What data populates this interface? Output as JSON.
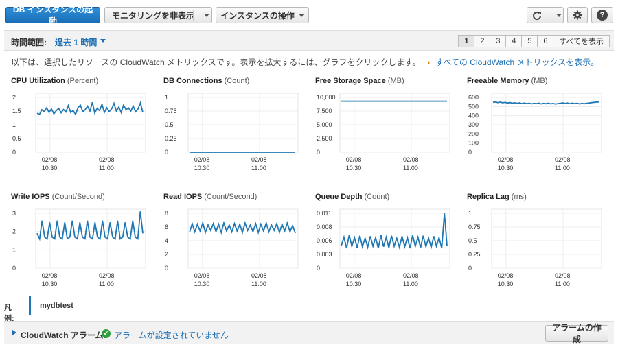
{
  "toolbar": {
    "launch_label": "DB インスタンスの起動",
    "monitoring_label": "モニタリングを非表示",
    "instance_actions_label": "インスタンスの操作",
    "refresh_icon": "refresh-icon",
    "settings_icon": "gear-icon",
    "help_icon": "help-icon",
    "help_glyph": "?"
  },
  "time_range": {
    "label": "時間範囲:",
    "value": "過去 1 時間",
    "pages": [
      "1",
      "2",
      "3",
      "4",
      "5",
      "6"
    ],
    "active_page": "1",
    "show_all_label": "すべてを表示"
  },
  "description": {
    "text": "以下は、選択したリソースの CloudWatch メトリックスです。表示を拡大するには、グラフをクリックします。",
    "arrow": "›",
    "link": "すべての CloudWatch メトリックスを表示。"
  },
  "colors": {
    "series": "#1f77b4",
    "primary": "#1f6fb2",
    "accent": "#e07b00",
    "ok": "#2f9e3f"
  },
  "chart_data": [
    {
      "type": "line",
      "title": "CPU Utilization",
      "unit": "(Percent)",
      "yticks": [
        "2",
        "1.5",
        "1",
        "0.5",
        "0"
      ],
      "ylim": [
        0,
        2
      ],
      "x": [
        "02/08\n10:30",
        "02/08\n11:00"
      ],
      "xticks": [
        {
          "date": "02/08",
          "time": "10:30"
        },
        {
          "date": "02/08",
          "time": "11:00"
        }
      ],
      "series": [
        {
          "name": "mydbtest",
          "values": [
            1.42,
            1.38,
            1.55,
            1.48,
            1.62,
            1.45,
            1.58,
            1.4,
            1.52,
            1.6,
            1.44,
            1.56,
            1.47,
            1.7,
            1.45,
            1.52,
            1.38,
            1.62,
            1.72,
            1.48,
            1.55,
            1.68,
            1.5,
            1.82,
            1.43,
            1.6,
            1.52,
            1.75,
            1.45,
            1.62,
            1.48,
            1.58,
            1.78,
            1.5,
            1.65,
            1.45,
            1.72,
            1.55,
            1.62,
            1.5,
            1.68,
            1.48,
            1.58,
            1.8,
            1.45
          ]
        }
      ],
      "grid": true
    },
    {
      "type": "line",
      "title": "DB Connections",
      "unit": "(Count)",
      "yticks": [
        "1",
        "0.75",
        "0.5",
        "0.25",
        "0"
      ],
      "ylim": [
        0,
        1
      ],
      "xticks": [
        {
          "date": "02/08",
          "time": "10:30"
        },
        {
          "date": "02/08",
          "time": "11:00"
        }
      ],
      "series": [
        {
          "name": "mydbtest",
          "values": [
            0,
            0,
            0,
            0,
            0,
            0,
            0,
            0,
            0,
            0
          ]
        }
      ],
      "grid": true
    },
    {
      "type": "line",
      "title": "Free Storage Space",
      "unit": "(MB)",
      "yticks": [
        "10,000",
        "7,500",
        "5,000",
        "2,500",
        "0"
      ],
      "ylim": [
        0,
        10000
      ],
      "xticks": [
        {
          "date": "02/08",
          "time": "10:30"
        },
        {
          "date": "02/08",
          "time": "11:00"
        }
      ],
      "series": [
        {
          "name": "mydbtest",
          "values": [
            9300,
            9300,
            9300,
            9300,
            9300,
            9300,
            9300,
            9300,
            9300,
            9300
          ]
        }
      ],
      "grid": true
    },
    {
      "type": "line",
      "title": "Freeable Memory",
      "unit": "(MB)",
      "yticks": [
        "600",
        "500",
        "400",
        "300",
        "200",
        "100",
        "0"
      ],
      "ylim": [
        0,
        600
      ],
      "xticks": [
        {
          "date": "02/08",
          "time": "10:30"
        },
        {
          "date": "02/08",
          "time": "11:00"
        }
      ],
      "series": [
        {
          "name": "mydbtest",
          "values": [
            545,
            550,
            542,
            548,
            540,
            545,
            538,
            543,
            536,
            541,
            534,
            540,
            532,
            538,
            530,
            536,
            529,
            534,
            531,
            537,
            528,
            534,
            530,
            536,
            529,
            533,
            527,
            532,
            535,
            540,
            533,
            538,
            531,
            537,
            530,
            536,
            528,
            534,
            530,
            535,
            538,
            542,
            545,
            548,
            550
          ]
        }
      ],
      "grid": true
    },
    {
      "type": "line",
      "title": "Write IOPS",
      "unit": "(Count/Second)",
      "yticks": [
        "3",
        "2",
        "1",
        "0"
      ],
      "ylim": [
        0,
        3
      ],
      "xticks": [
        {
          "date": "02/08",
          "time": "10:30"
        },
        {
          "date": "02/08",
          "time": "11:00"
        }
      ],
      "series": [
        {
          "name": "mydbtest",
          "values": [
            1.9,
            1.6,
            2.6,
            1.7,
            1.6,
            2.5,
            1.7,
            1.6,
            2.6,
            1.7,
            1.6,
            2.5,
            1.6,
            1.7,
            2.6,
            1.7,
            1.6,
            2.5,
            1.7,
            1.6,
            2.6,
            1.7,
            1.6,
            2.5,
            1.7,
            1.6,
            2.6,
            1.7,
            1.6,
            2.5,
            1.7,
            1.6,
            2.6,
            1.6,
            1.7,
            2.5,
            1.7,
            1.6,
            2.6,
            1.7,
            1.6,
            3.1,
            1.9
          ]
        }
      ],
      "grid": true
    },
    {
      "type": "line",
      "title": "Read IOPS",
      "unit": "(Count/Second)",
      "yticks": [
        "8",
        "6",
        "4",
        "2",
        "0"
      ],
      "ylim": [
        0,
        8
      ],
      "xticks": [
        {
          "date": "02/08",
          "time": "10:30"
        },
        {
          "date": "02/08",
          "time": "11:00"
        }
      ],
      "series": [
        {
          "name": "mydbtest",
          "values": [
            5.2,
            6.5,
            5.3,
            6.4,
            5.4,
            6.6,
            5.2,
            6.3,
            5.5,
            6.5,
            5.3,
            6.4,
            5.2,
            6.6,
            5.4,
            6.3,
            5.3,
            6.5,
            5.4,
            6.4,
            5.2,
            6.6,
            5.5,
            6.3,
            5.3,
            6.5,
            5.2,
            6.4,
            5.4,
            6.6,
            5.3,
            6.3,
            5.5,
            6.5,
            5.2,
            6.4,
            5.4,
            6.6,
            5.3,
            6.2,
            5.1
          ]
        }
      ],
      "grid": true
    },
    {
      "type": "line",
      "title": "Queue Depth",
      "unit": "(Count)",
      "yticks": [
        "0.011",
        "0.008",
        "0.006",
        "0.003",
        "0"
      ],
      "ylim": [
        0,
        0.011
      ],
      "xticks": [
        {
          "date": "02/08",
          "time": "10:30"
        },
        {
          "date": "02/08",
          "time": "11:00"
        }
      ],
      "series": [
        {
          "name": "mydbtest",
          "values": [
            0.0045,
            0.0062,
            0.004,
            0.0066,
            0.0044,
            0.0061,
            0.0041,
            0.0065,
            0.0043,
            0.006,
            0.0042,
            0.0064,
            0.0044,
            0.0061,
            0.004,
            0.0066,
            0.0043,
            0.0062,
            0.0041,
            0.0065,
            0.0044,
            0.006,
            0.0042,
            0.0064,
            0.0043,
            0.0061,
            0.004,
            0.0066,
            0.0044,
            0.0062,
            0.0041,
            0.0065,
            0.0043,
            0.006,
            0.0042,
            0.0064,
            0.0044,
            0.0061,
            0.004,
            0.011,
            0.0045
          ]
        }
      ],
      "grid": true
    },
    {
      "type": "line",
      "title": "Replica Lag",
      "unit": "(ms)",
      "yticks": [
        "1",
        "0.75",
        "0.5",
        "0.25",
        "0"
      ],
      "ylim": [
        0,
        1
      ],
      "xticks": [
        {
          "date": "02/08",
          "time": "10:30"
        },
        {
          "date": "02/08",
          "time": "11:00"
        }
      ],
      "series": [],
      "grid": true
    }
  ],
  "legend": {
    "label": "凡例:",
    "series_name": "mydbtest"
  },
  "alarm": {
    "label": "CloudWatch アラーム:",
    "status": "アラームが設定されていません",
    "create_label": "アラームの作成"
  }
}
